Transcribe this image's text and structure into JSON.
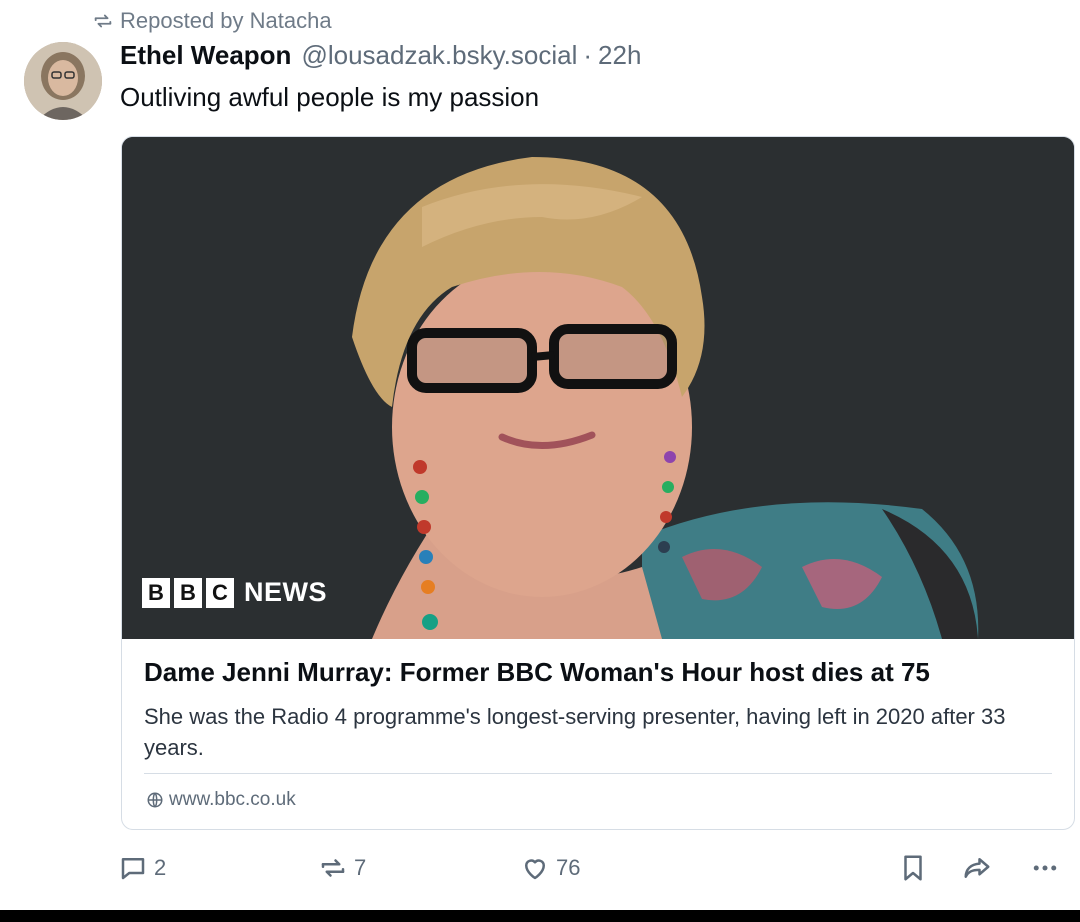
{
  "repost": {
    "label": "Reposted by Natacha"
  },
  "author": {
    "display_name": "Ethel Weapon",
    "handle": "@lousadzak.bsky.social",
    "separator": "·",
    "time": "22h"
  },
  "post": {
    "text": "Outliving awful people is my passion"
  },
  "card": {
    "logo": {
      "box_letters": [
        "B",
        "B",
        "C"
      ],
      "word": "NEWS"
    },
    "title": "Dame Jenni Murray: Former BBC Woman's Hour host dies at 75",
    "description": "She was the Radio 4 programme's longest-serving presenter, having left in 2020 after 33 years.",
    "domain": "www.bbc.co.uk"
  },
  "actions": {
    "replies": "2",
    "reposts": "7",
    "likes": "76"
  },
  "icons": {
    "repost": "repost-icon",
    "reply": "reply-icon",
    "like": "heart-icon",
    "bookmark": "bookmark-icon",
    "share": "share-icon",
    "more": "more-icon",
    "globe": "globe-icon"
  },
  "colors": {
    "muted": "#5e6b79",
    "text": "#0b0f14",
    "border": "#d6dde5",
    "photo_bg": "#2b2f31"
  }
}
